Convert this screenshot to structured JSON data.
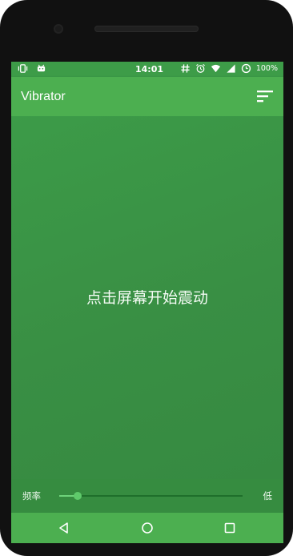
{
  "status_bar": {
    "time": "14:01",
    "battery_percent": "100%",
    "left_icons": [
      "vibrate-icon",
      "android-icon"
    ],
    "right_icons": [
      "hash-icon",
      "alarm-icon",
      "wifi-icon",
      "signal-icon",
      "data-saver-icon"
    ]
  },
  "app_bar": {
    "title": "Vibrator",
    "menu_icon": "filter-list-icon"
  },
  "main": {
    "prompt": "点击屏幕开始震动"
  },
  "frequency": {
    "label": "频率",
    "level_label": "低",
    "slider_value": 0.1
  },
  "nav_bar": {
    "icons": [
      "back-icon",
      "home-icon",
      "recents-icon"
    ]
  },
  "colors": {
    "accent": "#4caf50",
    "content_bg": "#3b9a47",
    "slider_active": "#6ed27a"
  }
}
